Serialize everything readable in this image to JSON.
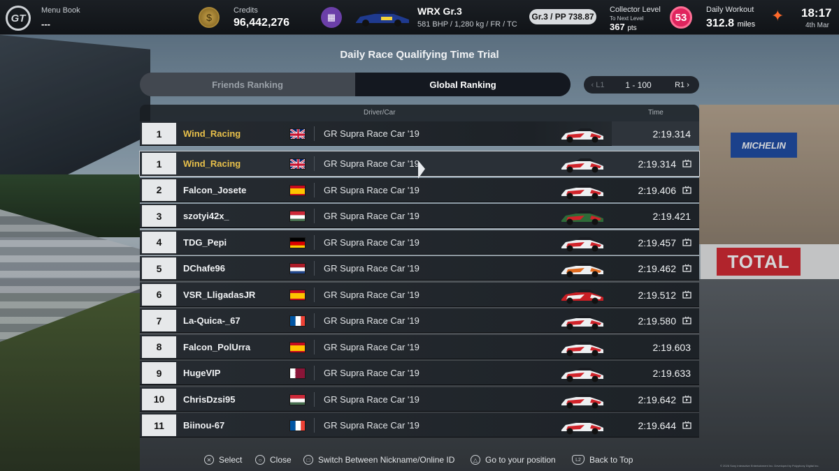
{
  "topbar": {
    "menu_label": "Menu Book",
    "menu_value": "---",
    "credits_label": "Credits",
    "credits_value": "96,442,276",
    "car_name": "WRX Gr.3",
    "car_specs": "581 BHP / 1,280 kg / FR / TC",
    "pp_badge": "Gr.3 / PP 738.87",
    "collector_label": "Collector Level",
    "collector_sub": "To Next Level",
    "collector_pts": "367",
    "collector_pts_unit": "pts",
    "collector_level": "53",
    "workout_label": "Daily Workout",
    "workout_value": "312.8",
    "workout_unit": "miles",
    "clock": "18:17",
    "date": "4th Mar"
  },
  "page_title": "Daily Race Qualifying Time Trial",
  "tabs": {
    "friends": "Friends Ranking",
    "global": "Global Ranking"
  },
  "pager": {
    "left": "L1",
    "range": "1 - 100",
    "right": "R1"
  },
  "table": {
    "col_driver_car": "Driver/Car",
    "col_time": "Time",
    "pinned": {
      "rank": "1",
      "name": "Wind_Racing",
      "flag": "uk",
      "car": "GR Supra Race Car '19",
      "time": "2:19.314"
    },
    "rows": [
      {
        "rank": "1",
        "name": "Wind_Racing",
        "flag": "uk",
        "car": "GR Supra Race Car '19",
        "time": "2:19.314",
        "replay": true,
        "livery": "red-white"
      },
      {
        "rank": "2",
        "name": "Falcon_Josete",
        "flag": "es",
        "car": "GR Supra Race Car '19",
        "time": "2:19.406",
        "replay": true,
        "livery": "red-white"
      },
      {
        "rank": "3",
        "name": "szotyi42x_",
        "flag": "hu",
        "car": "GR Supra Race Car '19",
        "time": "2:19.421",
        "replay": false,
        "livery": "green-red"
      },
      {
        "rank": "4",
        "name": "TDG_Pepi",
        "flag": "de",
        "car": "GR Supra Race Car '19",
        "time": "2:19.457",
        "replay": true,
        "livery": "red-white"
      },
      {
        "rank": "5",
        "name": "DChafe96",
        "flag": "nl",
        "car": "GR Supra Race Car '19",
        "time": "2:19.462",
        "replay": true,
        "livery": "orange-white"
      },
      {
        "rank": "6",
        "name": "VSR_LligadasJR",
        "flag": "es",
        "car": "GR Supra Race Car '19",
        "time": "2:19.512",
        "replay": true,
        "livery": "red"
      },
      {
        "rank": "7",
        "name": "La-Quica-_67",
        "flag": "fr",
        "car": "GR Supra Race Car '19",
        "time": "2:19.580",
        "replay": true,
        "livery": "red-white"
      },
      {
        "rank": "8",
        "name": "Falcon_PolUrra",
        "flag": "es",
        "car": "GR Supra Race Car '19",
        "time": "2:19.603",
        "replay": false,
        "livery": "red-white"
      },
      {
        "rank": "9",
        "name": "HugeVIP",
        "flag": "qa",
        "car": "GR Supra Race Car '19",
        "time": "2:19.633",
        "replay": false,
        "livery": "red-white"
      },
      {
        "rank": "10",
        "name": "ChrisDzsi95",
        "flag": "hu",
        "car": "GR Supra Race Car '19",
        "time": "2:19.642",
        "replay": true,
        "livery": "red-white"
      },
      {
        "rank": "11",
        "name": "Biinou-67",
        "flag": "fr",
        "car": "GR Supra Race Car '19",
        "time": "2:19.644",
        "replay": true,
        "livery": "red-white"
      }
    ]
  },
  "hints": {
    "select": "Select",
    "close": "Close",
    "switch": "Switch Between Nickname/Online ID",
    "goto": "Go to your position",
    "back": "Back to Top",
    "l2": "L2"
  },
  "copyright": "© 2026 Sony Interactive Entertainment Inc. Developed by Polyphony Digital Inc.",
  "background": {
    "michelin": "MICHELIN",
    "total": "TOTAL"
  },
  "colors": {
    "self_name": "#e8c04a",
    "level_badge": "#e0245e",
    "workout_icon": "#ff6a2b",
    "credits_coin": "#c7a24a"
  }
}
